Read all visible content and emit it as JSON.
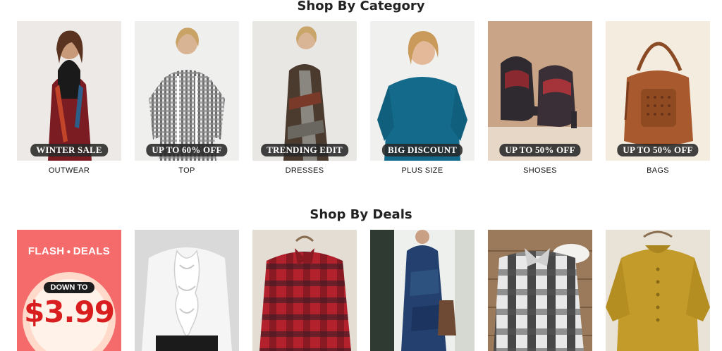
{
  "category_section": {
    "title": "Shop By Category",
    "items": [
      {
        "badge": "WINTER SALE",
        "label": "OUTWEAR"
      },
      {
        "badge": "UP TO 60% OFF",
        "label": "TOP"
      },
      {
        "badge": "TRENDING EDIT",
        "label": "DRESSES"
      },
      {
        "badge": "BIG DISCOUNT",
        "label": "PLUS SIZE"
      },
      {
        "badge": "UP TO 50% OFF",
        "label": "SHOSES"
      },
      {
        "badge": "UP TO 50% OFF",
        "label": "BAGS"
      }
    ]
  },
  "deals_section": {
    "title": "Shop By Deals",
    "flash": {
      "title_left": "FLASH",
      "title_right": "DEALS",
      "pill": "DOWN TO",
      "price": "$3.99"
    }
  },
  "colors": {
    "badge_bg": "#2a2a2a",
    "flash_bg": "#f56b6b",
    "price_red": "#d81e1e"
  }
}
